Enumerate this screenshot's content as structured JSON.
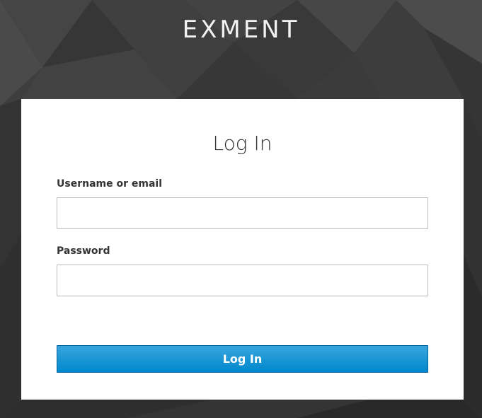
{
  "brand": {
    "name": "EXMENT"
  },
  "login_form": {
    "title": "Log In",
    "username": {
      "label": "Username or email",
      "value": "",
      "placeholder": ""
    },
    "password": {
      "label": "Password",
      "value": "",
      "placeholder": ""
    },
    "submit_label": "Log In"
  },
  "colors": {
    "background": "#3a3a3a",
    "card": "#ffffff",
    "button_top": "#39a5dc",
    "button_bottom": "#0088ce",
    "button_border": "#00659c",
    "brand_text": "#f2f2f2"
  }
}
